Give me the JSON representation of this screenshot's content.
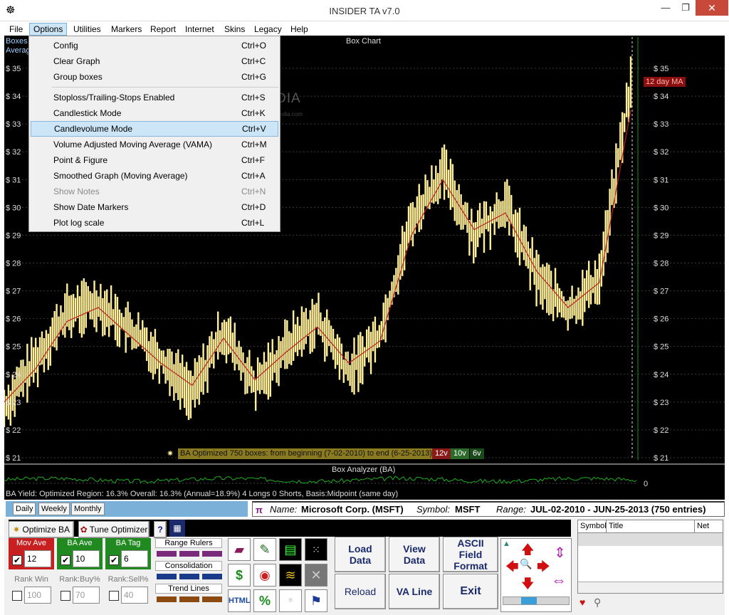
{
  "window": {
    "title": "INSIDER TA v7.0"
  },
  "menubar": [
    "File",
    "Options",
    "Utilities",
    "Markers",
    "Report",
    "Internet",
    "Skins",
    "Legacy",
    "Help"
  ],
  "options_menu": [
    {
      "label": "Config",
      "shortcut": "Ctrl+O",
      "disabled": false
    },
    {
      "label": "Clear Graph",
      "shortcut": "Ctrl+C",
      "disabled": false
    },
    {
      "label": "Group boxes",
      "shortcut": "Ctrl+G",
      "disabled": false
    },
    {
      "label": "Stoploss/Trailing-Stops Enabled",
      "shortcut": "Ctrl+S",
      "disabled": false
    },
    {
      "label": "Candlestick Mode",
      "shortcut": "Ctrl+K",
      "disabled": false
    },
    {
      "label": "Candlevolume Mode",
      "shortcut": "Ctrl+V",
      "disabled": false,
      "highlighted": true
    },
    {
      "label": "Volume Adjusted Moving Average (VAMA)",
      "shortcut": "Ctrl+M",
      "disabled": false
    },
    {
      "label": "Point & Figure",
      "shortcut": "Ctrl+F",
      "disabled": false
    },
    {
      "label": "Smoothed Graph (Moving Average)",
      "shortcut": "Ctrl+A",
      "disabled": false
    },
    {
      "label": "Show Notes",
      "shortcut": "Ctrl+N",
      "disabled": true
    },
    {
      "label": "Show Date Markers",
      "shortcut": "Ctrl+D",
      "disabled": false
    },
    {
      "label": "Plot log scale",
      "shortcut": "Ctrl+L",
      "disabled": false
    }
  ],
  "chart": {
    "title": "Box Chart",
    "topleft_1": "Boxes",
    "topleft_2": "Average",
    "ma_label": "12 day MA",
    "y_labels": [
      "$ 35",
      "$ 34",
      "$ 33",
      "$ 32",
      "$ 31",
      "$ 30",
      "$ 29",
      "$ 28",
      "$ 27",
      "$ 26",
      "$ 25",
      "$ 24",
      "$ 23",
      "$ 22",
      "$ 21"
    ],
    "status": "BA Optimized 750 boxes: from beginning (7-02-2010) to end (6-25-2013)",
    "status_tags": [
      "12v",
      "10v",
      "6v"
    ],
    "watermark": "SOFTPEDIA",
    "watermark_sub": "www.softpedia.com"
  },
  "chart_data": {
    "type": "line",
    "title": "Box Chart",
    "ylim": [
      21,
      35.5
    ],
    "x": [
      0,
      5,
      10,
      15,
      20,
      25,
      30,
      35,
      40,
      45,
      50,
      55,
      60,
      65,
      70,
      75,
      80,
      85,
      90,
      95,
      100
    ],
    "series": [
      {
        "name": "",
        "values": [
          22.8,
          24.5,
          26.2,
          26.6,
          25.6,
          24.6,
          23.3,
          25.6,
          23.5,
          25.0,
          26.0,
          24.0,
          25.5,
          29.5,
          31.3,
          29.0,
          30.1,
          27.5,
          26.2,
          27.5,
          34.5
        ]
      },
      {
        "name": "12 day MA",
        "values": [
          23.0,
          24.2,
          25.9,
          26.4,
          25.4,
          24.4,
          23.6,
          25.3,
          23.8,
          24.8,
          25.7,
          24.4,
          25.2,
          29.0,
          31.0,
          29.2,
          29.8,
          27.7,
          26.4,
          27.3,
          33.5
        ]
      }
    ]
  },
  "analyzer": {
    "title": "Box Analyzer (BA)",
    "zero": "0",
    "yield": "BA Yield: Optimized Region: 16.3% Overall: 16.3% (Annual=18.9%) 4 Longs 0 Shorts, Basis:Midpoint (same day)"
  },
  "tabs": [
    "Daily",
    "Weekly",
    "Monthly"
  ],
  "info": {
    "name_label": "Name:",
    "name_value": "Microsoft Corp. (MSFT)",
    "symbol_label": "Symbol:",
    "symbol_value": "MSFT",
    "range_label": "Range:",
    "range_value": "JUL-02-2010 - JUN-25-2013 (750 entries)"
  },
  "controls": {
    "optimize": "Optimize BA",
    "tune": "Tune Optimizer",
    "help": "?",
    "mov_ave": "Mov Ave",
    "ba_ave": "BA Ave",
    "ba_tag": "BA Tag",
    "mov_ave_val": "12",
    "ba_ave_val": "10",
    "ba_tag_val": "6",
    "rank_win": "Rank Win",
    "rank_buy": "Rank:Buy%",
    "rank_sell": "Rank:Sell%",
    "rank_win_val": "100",
    "rank_buy_val": "70",
    "rank_sell_val": "40",
    "range_rulers": "Range Rulers",
    "consolidation": "Consolidation",
    "trend_lines": "Trend Lines",
    "load_data": "Load Data",
    "view_data": "View Data",
    "ascii": "ASCII Field Format",
    "reload": "Reload",
    "va_line": "VA Line",
    "exit": "Exit"
  },
  "table_headers": [
    "Symbol",
    "Title",
    "Net"
  ],
  "colors": {
    "candle": "#ffef9a",
    "ma": "#c0201a",
    "grid": "#3a3a3a",
    "highlight": "#cde6f7"
  }
}
